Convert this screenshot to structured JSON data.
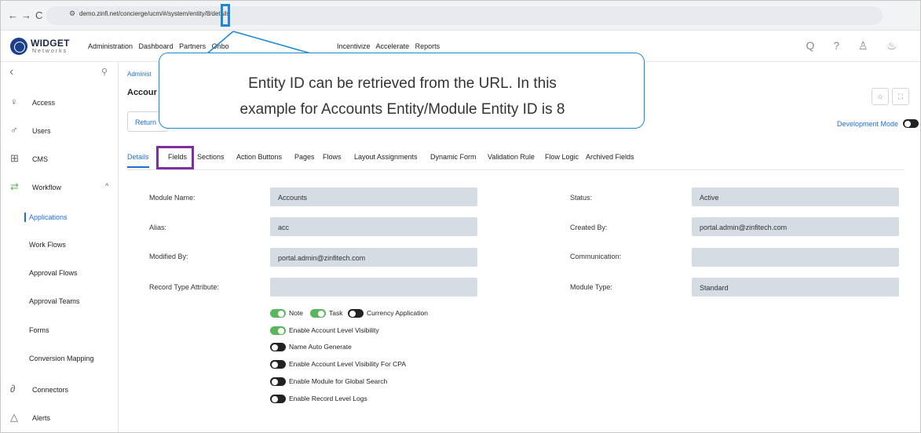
{
  "browser": {
    "back": "←",
    "forward": "→",
    "reload": "C",
    "site_icon": "⚙",
    "url": "demo.zinfi.net/concierge/ucm/#/system/entity/8/details"
  },
  "app": {
    "logo_title": "WIDGET",
    "logo_sub": "Networks",
    "menu_left": [
      "Administration",
      "Dashboard",
      "Partners",
      "Onbo"
    ],
    "menu_right": [
      "Incentivize",
      "Accelerate",
      "Reports"
    ],
    "top_icons": "Q ? ♙ ♨"
  },
  "sidebar": {
    "collapse": "‹",
    "pin": "⚲",
    "items": [
      {
        "label": "Access",
        "icon": "person-icon",
        "glyph": "♀"
      },
      {
        "label": "Users",
        "icon": "users-icon",
        "glyph": "♂"
      },
      {
        "label": "CMS",
        "icon": "grid-icon",
        "glyph": "⊞"
      },
      {
        "label": "Workflow",
        "icon": "workflow-icon",
        "glyph": "⇄"
      }
    ],
    "workflow_caret": "^",
    "subitems": [
      "Applications",
      "Work Flows",
      "Approval Flows",
      "Approval Teams",
      "Forms",
      "Conversion Mapping"
    ],
    "bottom_items": [
      {
        "label": "Connectors",
        "icon": "connector-icon",
        "glyph": "∂"
      },
      {
        "label": "Alerts",
        "icon": "bell-icon",
        "glyph": "△"
      }
    ]
  },
  "main": {
    "breadcrumb": "Administ",
    "page_title": "Accour",
    "return_label": "Return",
    "pin_icon": "☆",
    "expand_icon": "⛶",
    "dev_mode_label": "Development Mode",
    "tabs": [
      "Details",
      "Fields",
      "Sections",
      "Action Buttons",
      "Pages",
      "Flows",
      "Layout Assignments",
      "Dynamic Form",
      "Validation Rule",
      "Flow Logic",
      "Archived Fields"
    ],
    "fields": {
      "module_name_label": "Module Name:",
      "module_name_value": "Accounts",
      "alias_label": "Alias:",
      "alias_value": "acc",
      "modified_by_label": "Modified By:",
      "modified_by_value": "portal.admin@zinfitech.com",
      "record_type_label": "Record Type Attribute:",
      "record_type_value": "",
      "status_label": "Status:",
      "status_value": "Active",
      "created_by_label": "Created By:",
      "created_by_value": "portal.admin@zinfitech.com",
      "communication_label": "Communication:",
      "communication_value": "",
      "module_type_label": "Module Type:",
      "module_type_value": "Standard"
    },
    "options": {
      "note": "Note",
      "task": "Task",
      "currency": "Currency Application",
      "account_visibility": "Enable Account Level Visibility",
      "name_auto": "Name Auto Generate",
      "account_visibility_cpa": "Enable Account Level Visibility For CPA",
      "global_search": "Enable Module for Global Search",
      "record_logs": "Enable Record Level Logs"
    }
  },
  "callout": {
    "line1": "Entity ID can be retrieved from the URL. In this",
    "line2": "example for Accounts Entity/Module Entity ID is 8"
  },
  "colors": {
    "accent": "#1d6fd8",
    "callout_border": "#1e88d8",
    "fields_highlight": "#7b2fa0",
    "toggle_on": "#5bb55b",
    "field_bg": "#d5dce4"
  }
}
